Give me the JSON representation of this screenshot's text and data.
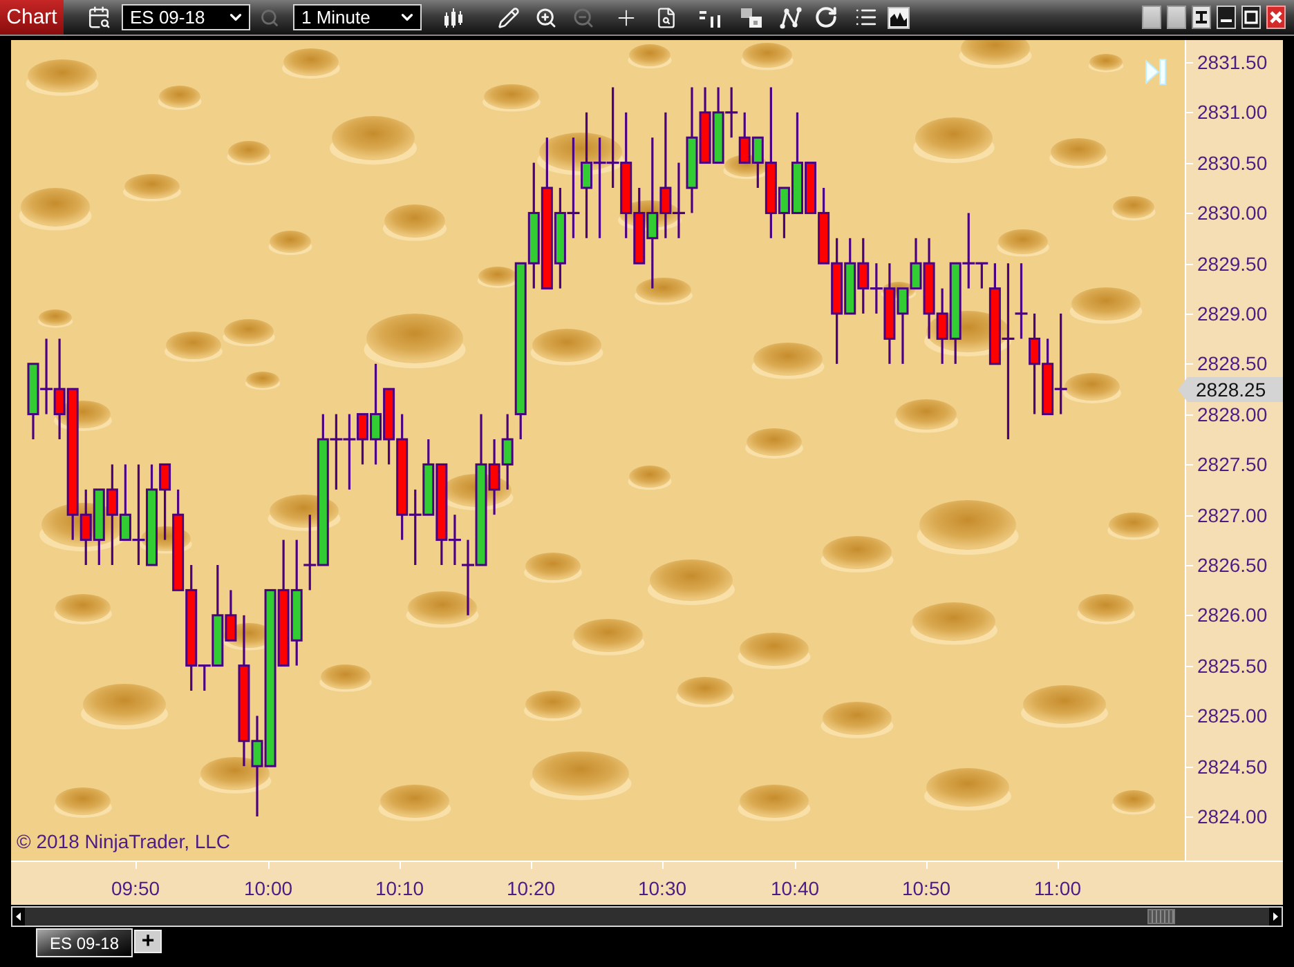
{
  "toolbar": {
    "title": "Chart",
    "instrument": "ES 09-18",
    "instrument_search": {
      "disabled": true
    },
    "interval": "1 Minute",
    "zoom_out": {
      "disabled": true
    }
  },
  "chart": {
    "y_axis_labels": [
      "2831.50",
      "2831.00",
      "2830.50",
      "2830.00",
      "2829.50",
      "2829.00",
      "2828.50",
      "2828.00",
      "2827.50",
      "2827.00",
      "2826.50",
      "2826.00",
      "2825.50",
      "2825.00",
      "2824.50",
      "2824.00"
    ],
    "current_price": "2828.25",
    "x_axis_labels": [
      "09:50",
      "10:00",
      "10:10",
      "10:20",
      "10:30",
      "10:40",
      "10:50",
      "11:00"
    ],
    "copyright": "© 2018 NinjaTrader, LLC"
  },
  "tabs": [
    {
      "label": "ES 09-18",
      "selected": true
    }
  ],
  "add_tab": "+"
}
